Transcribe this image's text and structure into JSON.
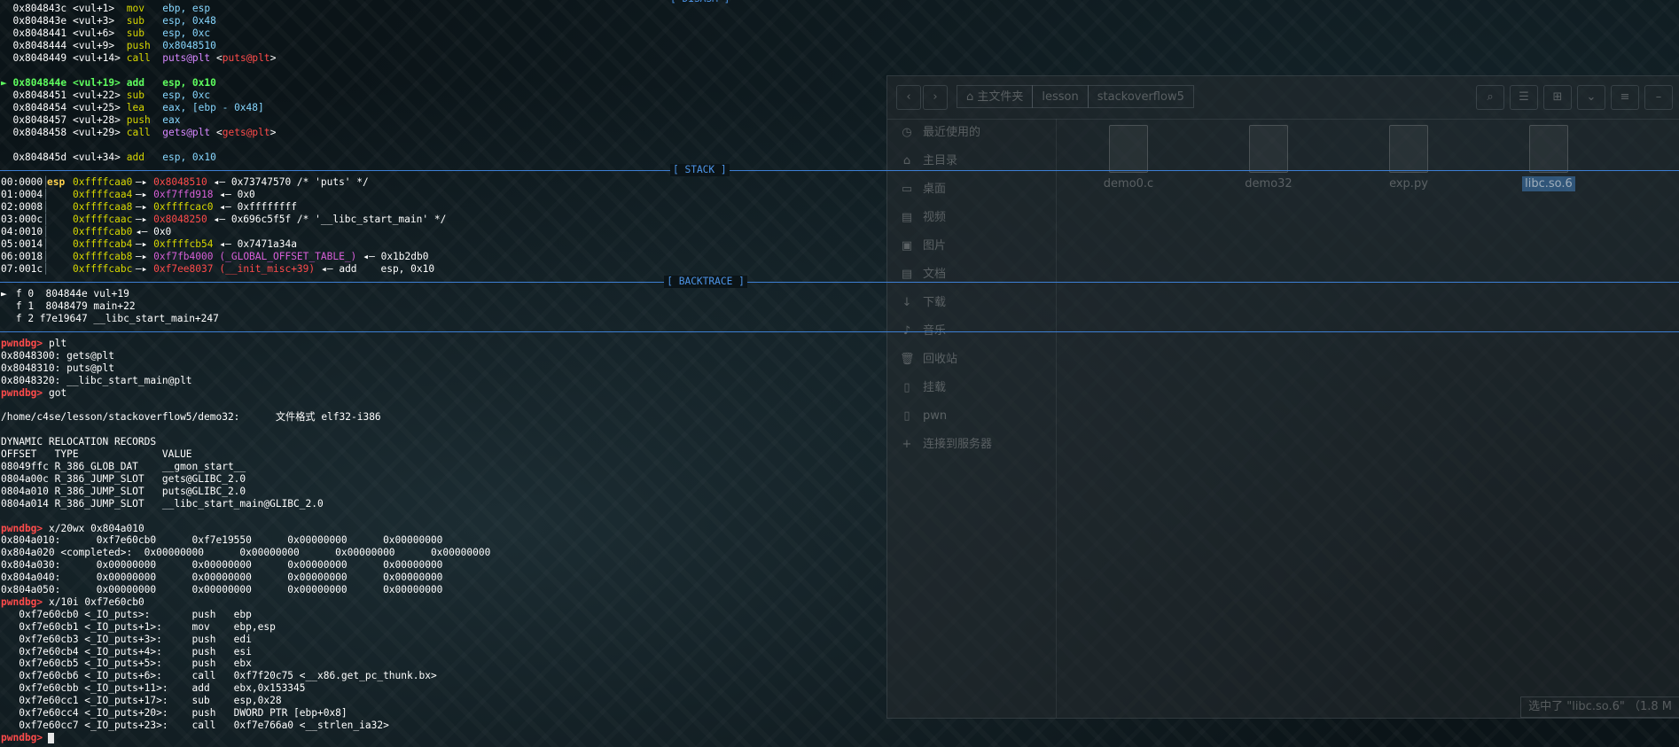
{
  "disasm_top_label": "[ DISASM ]",
  "disasm": [
    {
      "addr": "0x804843c",
      "sym": "<vul+1>",
      "mn": "mov",
      "ops": "ebp, esp"
    },
    {
      "addr": "0x804843e",
      "sym": "<vul+3>",
      "mn": "sub",
      "ops": "esp, 0x48"
    },
    {
      "addr": "0x8048441",
      "sym": "<vul+6>",
      "mn": "sub",
      "ops": "esp, 0xc"
    },
    {
      "addr": "0x8048444",
      "sym": "<vul+9>",
      "mn": "push",
      "ops": "0x8048510"
    },
    {
      "addr": "0x8048449",
      "sym": "<vul+14>",
      "mn": "call",
      "ops": "puts@plt",
      "ops2": "<puts@plt>"
    },
    {
      "addr": "0x804844e",
      "sym": "<vul+19>",
      "mn": "add",
      "ops": "esp, 0x10",
      "current": true,
      "marker": "►"
    },
    {
      "addr": "0x8048451",
      "sym": "<vul+22>",
      "mn": "sub",
      "ops": "esp, 0xc"
    },
    {
      "addr": "0x8048454",
      "sym": "<vul+25>",
      "mn": "lea",
      "ops": "eax, [ebp - 0x48]"
    },
    {
      "addr": "0x8048457",
      "sym": "<vul+28>",
      "mn": "push",
      "ops": "eax"
    },
    {
      "addr": "0x8048458",
      "sym": "<vul+29>",
      "mn": "call",
      "ops": "gets@plt",
      "ops2": "<gets@plt>"
    },
    {
      "addr": "0x804845d",
      "sym": "<vul+34>",
      "mn": "add",
      "ops": "esp, 0x10"
    }
  ],
  "stack_label": "[ STACK ]",
  "stack": [
    {
      "off": "00:0000",
      "reg": "esp",
      "addr": "0xffffcaa0",
      "p1": "0x8048510",
      "p1cls": "code-ptr",
      "tail": "◂— 0x73747570 /* 'puts' */"
    },
    {
      "off": "01:0004",
      "reg": "",
      "addr": "0xffffcaa4",
      "p1": "0xf7ffd918",
      "p1cls": "data-ptr",
      "tail": "◂— 0x0"
    },
    {
      "off": "02:0008",
      "reg": "",
      "addr": "0xffffcaa8",
      "p1": "0xffffcac0",
      "p1cls": "stk-ptr",
      "tail": "◂— 0xffffffff"
    },
    {
      "off": "03:000c",
      "reg": "",
      "addr": "0xffffcaac",
      "p1": "0x8048250",
      "p1cls": "code-ptr",
      "tail": "◂— 0x696c5f5f /* '__libc_start_main' */"
    },
    {
      "off": "04:0010",
      "reg": "",
      "addr": "0xffffcab0",
      "p1": "",
      "p1cls": "",
      "tail": "◂— 0x0"
    },
    {
      "off": "05:0014",
      "reg": "",
      "addr": "0xffffcab4",
      "p1": "0xffffcb54",
      "p1cls": "stk-ptr",
      "tail": "◂— 0x7471a34a"
    },
    {
      "off": "06:0018",
      "reg": "",
      "addr": "0xffffcab8",
      "p1": "0xf7fb4000",
      "p1cls": "data-ptr",
      "mid": "(_GLOBAL_OFFSET_TABLE_)",
      "tail": "◂— 0x1b2db0"
    },
    {
      "off": "07:001c",
      "reg": "",
      "addr": "0xffffcabc",
      "p1": "0xf7ee8037",
      "p1cls": "code-ptr",
      "mid": "(__init_misc+39)",
      "tail": "◂— add    esp, 0x10"
    }
  ],
  "backtrace_label": "[ BACKTRACE ]",
  "backtrace": [
    {
      "marker": "►",
      "text": " f 0  804844e vul+19"
    },
    {
      "marker": "",
      "text": " f 1  8048479 main+22"
    },
    {
      "marker": "",
      "text": " f 2 f7e19647 __libc_start_main+247"
    }
  ],
  "prompt": "pwndbg>",
  "session": {
    "cmd_plt": "plt",
    "plt_lines": [
      "0x8048300: gets@plt",
      "0x8048310: puts@plt",
      "0x8048320: __libc_start_main@plt"
    ],
    "cmd_got": "got",
    "got_file": "/home/c4se/lesson/stackoverflow5/demo32:      文件格式 elf32-i386",
    "reloc_title": "DYNAMIC RELOCATION RECORDS",
    "reloc_header": "OFFSET   TYPE              VALUE",
    "reloc_rows": [
      "08049ffc R_386_GLOB_DAT    __gmon_start__",
      "0804a00c R_386_JUMP_SLOT   gets@GLIBC_2.0",
      "0804a010 R_386_JUMP_SLOT   puts@GLIBC_2.0",
      "0804a014 R_386_JUMP_SLOT   __libc_start_main@GLIBC_2.0"
    ],
    "cmd_x20": "x/20wx 0x804a010",
    "mem_rows": [
      "0x804a010:      0xf7e60cb0      0xf7e19550      0x00000000      0x00000000",
      "0x804a020 <completed>:  0x00000000      0x00000000      0x00000000      0x00000000",
      "0x804a030:      0x00000000      0x00000000      0x00000000      0x00000000",
      "0x804a040:      0x00000000      0x00000000      0x00000000      0x00000000",
      "0x804a050:      0x00000000      0x00000000      0x00000000      0x00000000"
    ],
    "cmd_x10i": "x/10i 0xf7e60cb0",
    "insn_rows": [
      "   0xf7e60cb0 <_IO_puts>:       push   ebp",
      "   0xf7e60cb1 <_IO_puts+1>:     mov    ebp,esp",
      "   0xf7e60cb3 <_IO_puts+3>:     push   edi",
      "   0xf7e60cb4 <_IO_puts+4>:     push   esi",
      "   0xf7e60cb5 <_IO_puts+5>:     push   ebx",
      "   0xf7e60cb6 <_IO_puts+6>:     call   0xf7f20c75 <__x86.get_pc_thunk.bx>",
      "   0xf7e60cbb <_IO_puts+11>:    add    ebx,0x153345",
      "   0xf7e60cc1 <_IO_puts+17>:    sub    esp,0x28",
      "   0xf7e60cc4 <_IO_puts+20>:    push   DWORD PTR [ebp+0x8]",
      "   0xf7e60cc7 <_IO_puts+23>:    call   0xf7e766a0 <__strlen_ia32>"
    ]
  },
  "file_manager": {
    "crumbs": [
      "主文件夹",
      "lesson",
      "stackoverflow5"
    ],
    "sidebar": [
      {
        "icon": "clock-icon",
        "glyph": "◷",
        "label": "最近使用的"
      },
      {
        "icon": "home-icon",
        "glyph": "⌂",
        "label": "主目录"
      },
      {
        "icon": "desktop-icon",
        "glyph": "▭",
        "label": "桌面"
      },
      {
        "icon": "document-icon",
        "glyph": "▤",
        "label": "视频"
      },
      {
        "icon": "picture-icon",
        "glyph": "▣",
        "label": "图片"
      },
      {
        "icon": "document-icon",
        "glyph": "▤",
        "label": "文档"
      },
      {
        "icon": "download-icon",
        "glyph": "↓",
        "label": "下载"
      },
      {
        "icon": "music-icon",
        "glyph": "♪",
        "label": "音乐"
      },
      {
        "icon": "trash-icon",
        "glyph": "🗑",
        "label": "回收站"
      },
      {
        "icon": "drive-icon",
        "glyph": "▯",
        "label": "挂载"
      },
      {
        "icon": "drive-icon",
        "glyph": "▯",
        "label": "pwn"
      },
      {
        "icon": "network-icon",
        "glyph": "+",
        "label": "连接到服务器"
      }
    ],
    "files": [
      {
        "name": "demo0.c",
        "selected": false
      },
      {
        "name": "demo32",
        "selected": false
      },
      {
        "name": "exp.py",
        "selected": false
      },
      {
        "name": "libc.so.6",
        "selected": true
      }
    ],
    "status": "选中了 \"libc.so.6\" （1.8 M"
  }
}
